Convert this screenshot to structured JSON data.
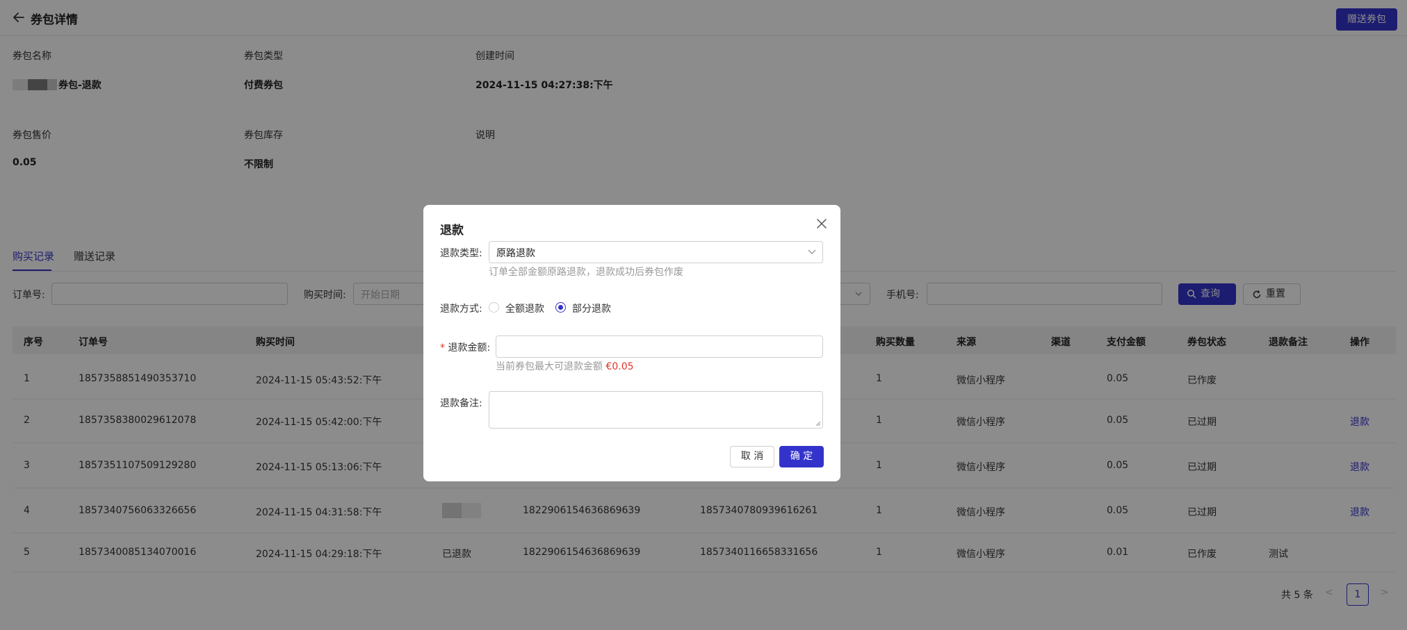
{
  "header": {
    "title": "券包详情",
    "gift_button": "赠送券包"
  },
  "info": {
    "name_label": "券包名称",
    "name_value": "券包-退款",
    "type_label": "券包类型",
    "type_value": "付费券包",
    "created_label": "创建时间",
    "created_value": "2024-11-15 04:27:38:下午",
    "price_label": "券包售价",
    "price_value": "0.05",
    "stock_label": "券包库存",
    "stock_value": "不限制",
    "desc_label": "说明"
  },
  "tabs": [
    {
      "label": "购买记录",
      "active": true
    },
    {
      "label": "赠送记录",
      "active": false
    }
  ],
  "filters": {
    "order_label": "订单号:",
    "time_label": "购买时间:",
    "start_placeholder": "开始日期",
    "phone_label": "手机号:",
    "query_button": "查询",
    "reset_button": "重置"
  },
  "table": {
    "columns": [
      "序号",
      "订单号",
      "购买时间",
      "购买数量",
      "来源",
      "渠道",
      "支付金额",
      "券包状态",
      "退款备注",
      "操作"
    ],
    "rows": [
      {
        "no": "1",
        "order": "1857358851490353710",
        "time": "2024-11-15 05:43:52:下午",
        "refund_state": "",
        "user_id": "",
        "trade_no": "",
        "qty": "1",
        "source": "微信小程序",
        "amount": "0.05",
        "status": "已作废",
        "remark": "",
        "action": ""
      },
      {
        "no": "2",
        "order": "1857358380029612078",
        "time": "2024-11-15 05:42:00:下午",
        "refund_state": "",
        "user_id": "",
        "trade_no": "",
        "qty": "1",
        "source": "微信小程序",
        "amount": "0.05",
        "status": "已过期",
        "remark": "",
        "action": "退款"
      },
      {
        "no": "3",
        "order": "1857351107509129280",
        "time": "2024-11-15 05:13:06:下午",
        "refund_state": "",
        "user_id": "",
        "trade_no": "",
        "qty": "1",
        "source": "微信小程序",
        "amount": "0.05",
        "status": "已过期",
        "remark": "",
        "action": "退款"
      },
      {
        "no": "4",
        "order": "1857340756063326656",
        "time": "2024-11-15 04:31:58:下午",
        "refund_state": "",
        "user_id": "1822906154636869639",
        "trade_no": "1857340780939616261",
        "qty": "1",
        "source": "微信小程序",
        "amount": "0.05",
        "status": "已过期",
        "remark": "",
        "action": "退款"
      },
      {
        "no": "5",
        "order": "1857340085134070016",
        "time": "2024-11-15 04:29:18:下午",
        "refund_state": "已退款",
        "user_id": "1822906154636869639",
        "trade_no": "1857340116658331656",
        "qty": "1",
        "source": "微信小程序",
        "amount": "0.01",
        "status": "已作废",
        "remark": "测试",
        "action": ""
      }
    ]
  },
  "pagination": {
    "total": "共 5 条",
    "current": "1",
    "prev": "<",
    "next": ">"
  },
  "modal": {
    "title": "退款",
    "type_label": "退款类型:",
    "type_value": "原路退款",
    "type_help": "订单全部金额原路退款，退款成功后券包作废",
    "method_label": "退款方式:",
    "method_full": "全额退款",
    "method_partial": "部分退款",
    "method_selected": "部分退款",
    "required_mark": "*",
    "amount_label": "退款金额:",
    "amount_help": "当前券包最大可退款金额",
    "amount_max": "€0.05",
    "remark_label": "退款备注:",
    "cancel": "取 消",
    "confirm": "确 定"
  },
  "colors": {
    "accent": "#3333cc",
    "danger": "#e0342d",
    "overlay": "rgba(0,0,0,0.45)"
  }
}
